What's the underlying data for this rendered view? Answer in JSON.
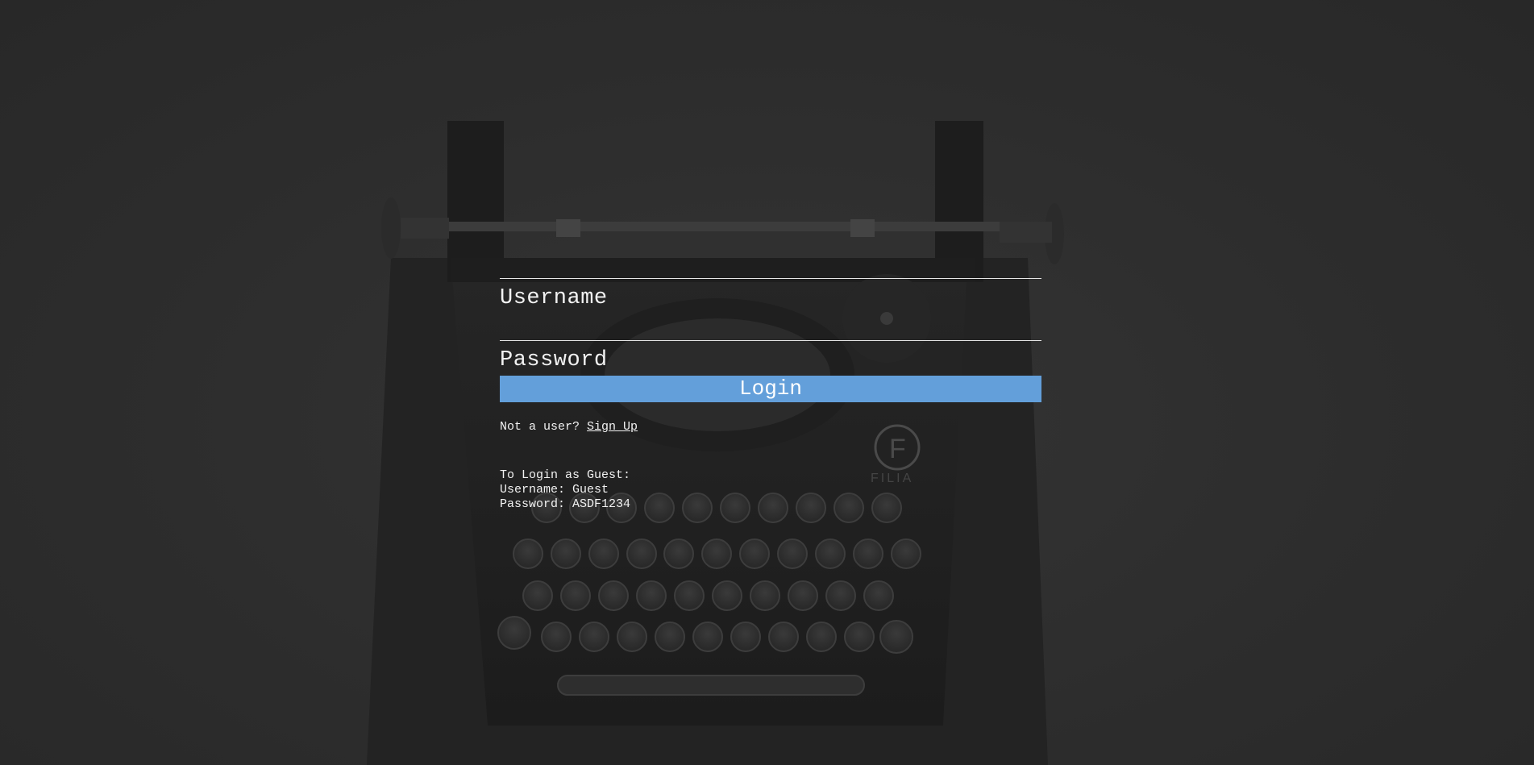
{
  "login_form": {
    "username_label": "Username",
    "password_label": "Password",
    "login_button": "Login",
    "signup_prompt": "Not a user?",
    "signup_link": "Sign Up"
  },
  "guest_info": {
    "heading": "To Login as Guest:",
    "username_line": "Username: Guest",
    "password_line": "Password: ASDF1234"
  },
  "background": {
    "image": "typewriter-photo",
    "brand_badge": "FILIA",
    "brand_letter": "F"
  },
  "colors": {
    "page_background": "#2e2e2e",
    "button_accent": "#639fda",
    "text": "#f2f2f2"
  }
}
